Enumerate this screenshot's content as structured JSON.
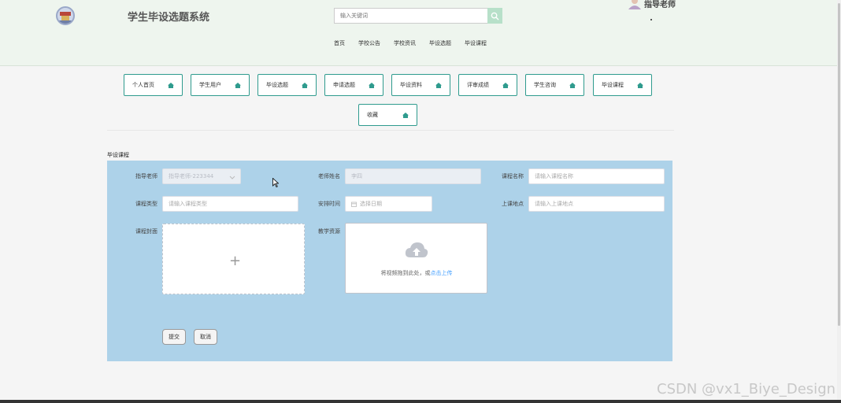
{
  "header": {
    "site_title": "学生毕设选题系统",
    "search_placeholder": "输入关键词",
    "user_name": "指导老师"
  },
  "nav": [
    "首页",
    "学校公告",
    "学校资讯",
    "毕设选题",
    "毕设课程"
  ],
  "menu": [
    "个人首页",
    "学生用户",
    "毕设选题",
    "申请选题",
    "毕设资料",
    "评审成绩",
    "学生咨询",
    "毕设课程",
    "收藏"
  ],
  "form": {
    "section_title": "毕设课程",
    "teacher_label": "指导老师",
    "teacher_value": "指导老师-223344",
    "teacher_name_label": "老师姓名",
    "teacher_name_value": "李四",
    "course_name_label": "课程名称",
    "course_name_placeholder": "请输入课程名称",
    "course_type_label": "课程类型",
    "course_type_placeholder": "请输入课程类型",
    "schedule_label": "安排时间",
    "schedule_placeholder": "选择日期",
    "location_label": "上课地点",
    "location_placeholder": "请输入上课地点",
    "cover_label": "课程封面",
    "resource_label": "教学资源",
    "upload_hint": "将视频拖到此处，或",
    "upload_link": "点击上传",
    "submit": "提交",
    "cancel": "取消"
  },
  "watermark": "CSDN @vx1_Biye_Design",
  "colors": {
    "header_bg": "#eef5ee",
    "accent": "#2f9b8e",
    "panel_bg": "#add2e9",
    "link": "#409eff"
  }
}
